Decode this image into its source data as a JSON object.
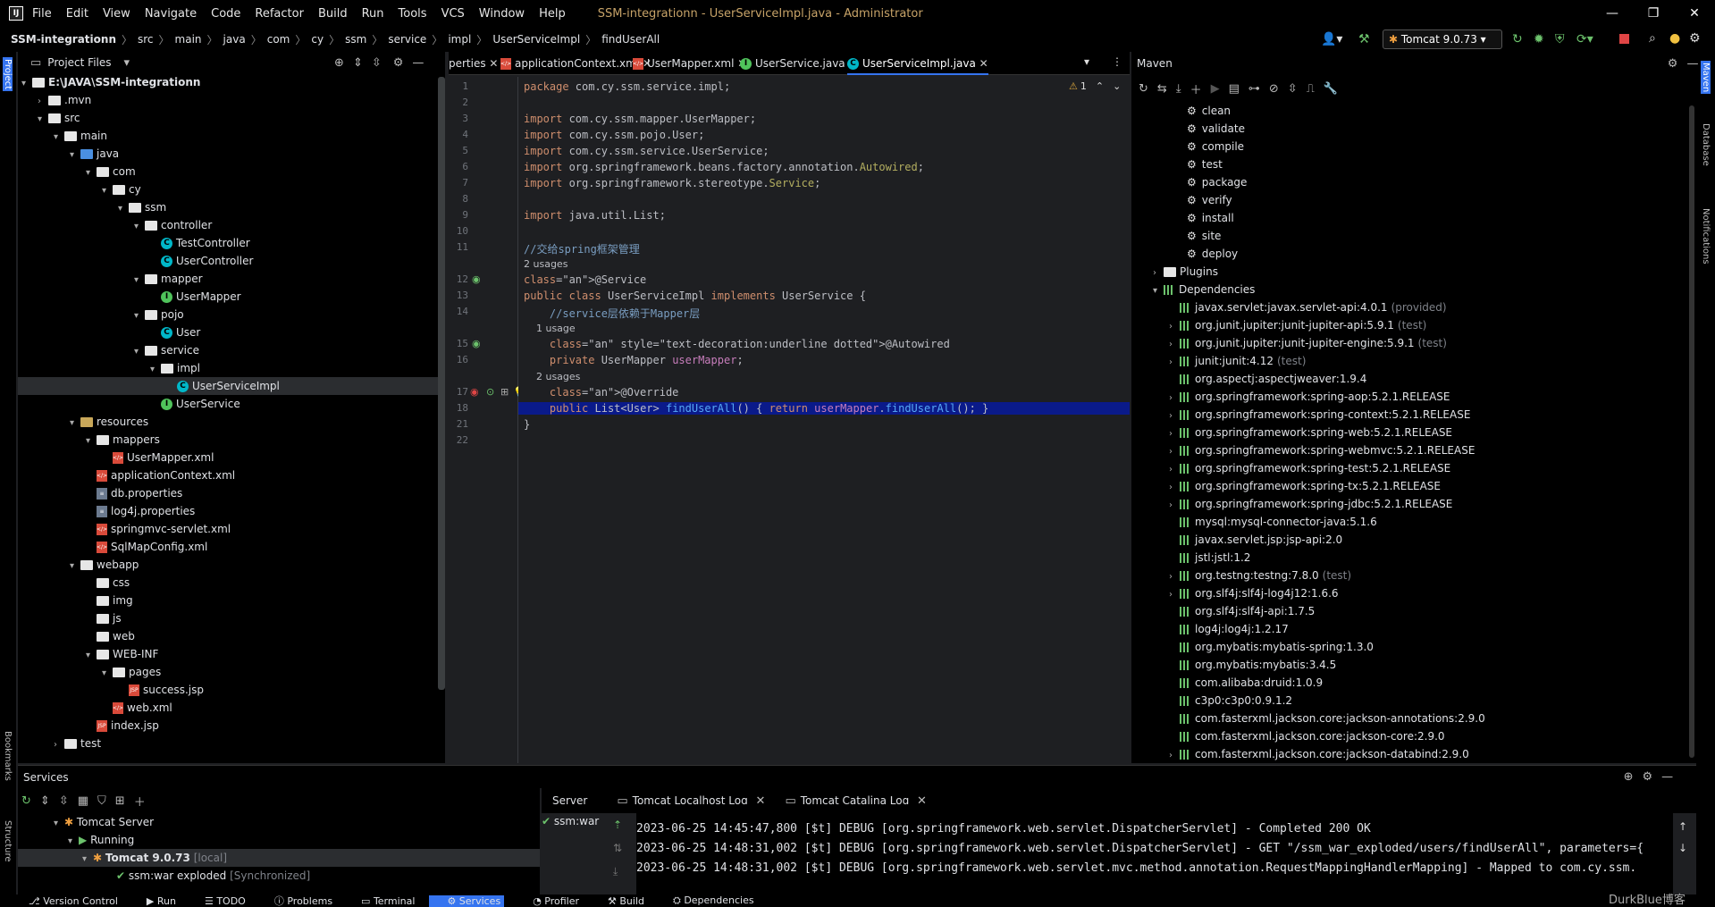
{
  "window": {
    "title": "SSM-integrationn - UserServiceImpl.java - Administrator",
    "menu": [
      "File",
      "Edit",
      "View",
      "Navigate",
      "Code",
      "Refactor",
      "Build",
      "Run",
      "Tools",
      "VCS",
      "Window",
      "Help"
    ]
  },
  "breadcrumb": [
    "SSM-integrationn",
    "src",
    "main",
    "java",
    "com",
    "cy",
    "ssm",
    "service",
    "impl",
    "UserServiceImpl",
    "findUserAll"
  ],
  "run_config": "Tomcat 9.0.73",
  "project_panel": {
    "title": "Project Files",
    "tree": [
      {
        "label": "E:\\JAVA\\SSM-integrationn",
        "depth": 0,
        "icon": "folder",
        "open": true
      },
      {
        "label": ".mvn",
        "depth": 1,
        "icon": "folder",
        "open": false
      },
      {
        "label": "src",
        "depth": 1,
        "icon": "folder",
        "open": true
      },
      {
        "label": "main",
        "depth": 2,
        "icon": "folder",
        "open": true
      },
      {
        "label": "java",
        "depth": 3,
        "icon": "folder-blue",
        "open": true
      },
      {
        "label": "com",
        "depth": 4,
        "icon": "folder",
        "open": true
      },
      {
        "label": "cy",
        "depth": 5,
        "icon": "folder",
        "open": true
      },
      {
        "label": "ssm",
        "depth": 6,
        "icon": "folder",
        "open": true
      },
      {
        "label": "controller",
        "depth": 7,
        "icon": "folder",
        "open": true
      },
      {
        "label": "TestController",
        "depth": 8,
        "icon": "class"
      },
      {
        "label": "UserController",
        "depth": 8,
        "icon": "class"
      },
      {
        "label": "mapper",
        "depth": 7,
        "icon": "folder",
        "open": true
      },
      {
        "label": "UserMapper",
        "depth": 8,
        "icon": "interface"
      },
      {
        "label": "pojo",
        "depth": 7,
        "icon": "folder",
        "open": true
      },
      {
        "label": "User",
        "depth": 8,
        "icon": "class"
      },
      {
        "label": "service",
        "depth": 7,
        "icon": "folder",
        "open": true
      },
      {
        "label": "impl",
        "depth": 8,
        "icon": "folder",
        "open": true
      },
      {
        "label": "UserServiceImpl",
        "depth": 9,
        "icon": "class",
        "selected": true
      },
      {
        "label": "UserService",
        "depth": 8,
        "icon": "interface"
      },
      {
        "label": "resources",
        "depth": 3,
        "icon": "folder-res",
        "open": true
      },
      {
        "label": "mappers",
        "depth": 4,
        "icon": "folder",
        "open": true
      },
      {
        "label": "UserMapper.xml",
        "depth": 5,
        "icon": "xml"
      },
      {
        "label": "applicationContext.xml",
        "depth": 4,
        "icon": "xml"
      },
      {
        "label": "db.properties",
        "depth": 4,
        "icon": "prop"
      },
      {
        "label": "log4j.properties",
        "depth": 4,
        "icon": "prop"
      },
      {
        "label": "springmvc-servlet.xml",
        "depth": 4,
        "icon": "xml"
      },
      {
        "label": "SqlMapConfig.xml",
        "depth": 4,
        "icon": "xml"
      },
      {
        "label": "webapp",
        "depth": 3,
        "icon": "folder",
        "open": true
      },
      {
        "label": "css",
        "depth": 4,
        "icon": "folder"
      },
      {
        "label": "img",
        "depth": 4,
        "icon": "folder"
      },
      {
        "label": "js",
        "depth": 4,
        "icon": "folder"
      },
      {
        "label": "web",
        "depth": 4,
        "icon": "folder"
      },
      {
        "label": "WEB-INF",
        "depth": 4,
        "icon": "folder",
        "open": true
      },
      {
        "label": "pages",
        "depth": 5,
        "icon": "folder",
        "open": true
      },
      {
        "label": "success.jsp",
        "depth": 6,
        "icon": "jsp"
      },
      {
        "label": "web.xml",
        "depth": 5,
        "icon": "xml"
      },
      {
        "label": "index.jsp",
        "depth": 4,
        "icon": "jsp"
      },
      {
        "label": "test",
        "depth": 2,
        "icon": "folder",
        "open": false
      }
    ]
  },
  "editor": {
    "tabs": [
      {
        "label": "perties",
        "active": false
      },
      {
        "label": "applicationContext.xml",
        "active": false
      },
      {
        "label": "UserMapper.xml",
        "active": false
      },
      {
        "label": "UserService.java",
        "active": false
      },
      {
        "label": "UserServiceImpl.java",
        "active": true
      }
    ],
    "warning_count": "1",
    "lines": [
      {
        "n": "1",
        "text": "package com.cy.ssm.service.impl;"
      },
      {
        "n": "2",
        "text": ""
      },
      {
        "n": "3",
        "text": "import com.cy.ssm.mapper.UserMapper;"
      },
      {
        "n": "4",
        "text": "import com.cy.ssm.pojo.User;"
      },
      {
        "n": "5",
        "text": "import com.cy.ssm.service.UserService;"
      },
      {
        "n": "6",
        "text": "import org.springframework.beans.factory.annotation.Autowired;"
      },
      {
        "n": "7",
        "text": "import org.springframework.stereotype.Service;"
      },
      {
        "n": "8",
        "text": ""
      },
      {
        "n": "9",
        "text": "import java.util.List;"
      },
      {
        "n": "10",
        "text": ""
      },
      {
        "n": "11",
        "text": "//交给spring框架管理"
      },
      {
        "n": "",
        "text": "2 usages"
      },
      {
        "n": "12",
        "text": "@Service"
      },
      {
        "n": "13",
        "text": "public class UserServiceImpl implements UserService {"
      },
      {
        "n": "14",
        "text": "    //service层依赖于Mapper层"
      },
      {
        "n": "",
        "text": "    1 usage"
      },
      {
        "n": "15",
        "text": "    @Autowired"
      },
      {
        "n": "16",
        "text": "    private UserMapper userMapper;"
      },
      {
        "n": "",
        "text": "    2 usages"
      },
      {
        "n": "17",
        "text": "    @Override"
      },
      {
        "n": "18",
        "text": "    public List<User> findUserAll() { return userMapper.findUserAll(); }"
      },
      {
        "n": "21",
        "text": "}"
      },
      {
        "n": "22",
        "text": ""
      }
    ]
  },
  "maven": {
    "title": "Maven",
    "lifecycle": [
      "clean",
      "validate",
      "compile",
      "test",
      "package",
      "verify",
      "install",
      "site",
      "deploy"
    ],
    "plugins_label": "Plugins",
    "dependencies_label": "Dependencies",
    "dependencies": [
      {
        "name": "javax.servlet:javax.servlet-api:4.0.1",
        "scope": "(provided)",
        "expand": false
      },
      {
        "name": "org.junit.jupiter:junit-jupiter-api:5.9.1",
        "scope": "(test)",
        "expand": true
      },
      {
        "name": "org.junit.jupiter:junit-jupiter-engine:5.9.1",
        "scope": "(test)",
        "expand": true
      },
      {
        "name": "junit:junit:4.12",
        "scope": "(test)",
        "expand": true
      },
      {
        "name": "org.aspectj:aspectjweaver:1.9.4",
        "scope": "",
        "expand": false
      },
      {
        "name": "org.springframework:spring-aop:5.2.1.RELEASE",
        "scope": "",
        "expand": true
      },
      {
        "name": "org.springframework:spring-context:5.2.1.RELEASE",
        "scope": "",
        "expand": true
      },
      {
        "name": "org.springframework:spring-web:5.2.1.RELEASE",
        "scope": "",
        "expand": true
      },
      {
        "name": "org.springframework:spring-webmvc:5.2.1.RELEASE",
        "scope": "",
        "expand": true
      },
      {
        "name": "org.springframework:spring-test:5.2.1.RELEASE",
        "scope": "",
        "expand": true
      },
      {
        "name": "org.springframework:spring-tx:5.2.1.RELEASE",
        "scope": "",
        "expand": true
      },
      {
        "name": "org.springframework:spring-jdbc:5.2.1.RELEASE",
        "scope": "",
        "expand": true
      },
      {
        "name": "mysql:mysql-connector-java:5.1.6",
        "scope": "",
        "expand": false
      },
      {
        "name": "javax.servlet.jsp:jsp-api:2.0",
        "scope": "",
        "expand": false
      },
      {
        "name": "jstl:jstl:1.2",
        "scope": "",
        "expand": false
      },
      {
        "name": "org.testng:testng:7.8.0",
        "scope": "(test)",
        "expand": true
      },
      {
        "name": "org.slf4j:slf4j-log4j12:1.6.6",
        "scope": "",
        "expand": true
      },
      {
        "name": "org.slf4j:slf4j-api:1.7.5",
        "scope": "",
        "expand": false
      },
      {
        "name": "log4j:log4j:1.2.17",
        "scope": "",
        "expand": false
      },
      {
        "name": "org.mybatis:mybatis-spring:1.3.0",
        "scope": "",
        "expand": false
      },
      {
        "name": "org.mybatis:mybatis:3.4.5",
        "scope": "",
        "expand": false
      },
      {
        "name": "com.alibaba:druid:1.0.9",
        "scope": "",
        "expand": false
      },
      {
        "name": "c3p0:c3p0:0.9.1.2",
        "scope": "",
        "expand": false
      },
      {
        "name": "com.fasterxml.jackson.core:jackson-annotations:2.9.0",
        "scope": "",
        "expand": false
      },
      {
        "name": "com.fasterxml.jackson.core:jackson-core:2.9.0",
        "scope": "",
        "expand": false
      },
      {
        "name": "com.fasterxml.jackson.core:jackson-databind:2.9.0",
        "scope": "",
        "expand": true
      }
    ]
  },
  "services": {
    "title": "Services",
    "tree": {
      "server": "Tomcat Server",
      "running": "Running",
      "tomcat": "Tomcat 9.0.73",
      "tomcat_tag": "[local]",
      "artifact": "ssm:war exploded",
      "artifact_tag": "[Synchronized]"
    },
    "log_tabs": [
      "Server",
      "Tomcat Localhost Log",
      "Tomcat Catalina Log"
    ],
    "deploy_item": "ssm:war",
    "log_lines": [
      "2023-06-25 14:45:47,800 [$t] DEBUG [org.springframework.web.servlet.DispatcherServlet] - Completed 200 OK",
      "2023-06-25 14:48:31,002 [$t] DEBUG [org.springframework.web.servlet.DispatcherServlet] - GET \"/ssm_war_exploded/users/findUserAll\", parameters={",
      "2023-06-25 14:48:31,002 [$t] DEBUG [org.springframework.web.servlet.mvc.method.annotation.RequestMappingHandlerMapping] - Mapped to com.cy.ssm."
    ]
  },
  "left_strip": {
    "project": "Project",
    "bookmarks": "Bookmarks",
    "structure": "Structure"
  },
  "right_strip": {
    "maven": "Maven",
    "database": "Database",
    "notifications": "Notifications"
  },
  "statusbar": [
    "Version Control",
    "Run",
    "TODO",
    "Problems",
    "Terminal",
    "Services",
    "Profiler",
    "Build",
    "Dependencies"
  ],
  "watermark": "DurkBlue博客"
}
